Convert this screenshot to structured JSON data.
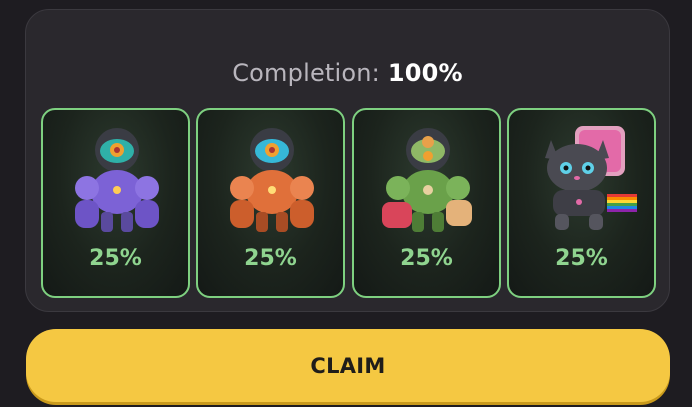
{
  "completion": {
    "label": "Completion:",
    "value": "100%"
  },
  "cards": [
    {
      "name": "purple-robot-icon",
      "percent": "25%",
      "body_color": "#7c62d6",
      "accent": "#a993f0"
    },
    {
      "name": "orange-robot-icon",
      "percent": "25%",
      "body_color": "#e0703a",
      "accent": "#f29a5f"
    },
    {
      "name": "green-robot-icon",
      "percent": "25%",
      "body_color": "#6aa14a",
      "accent": "#d9455a"
    },
    {
      "name": "robot-cat-icon",
      "percent": "25%",
      "body_color": "#4a4a52",
      "accent": "#e36aa8"
    }
  ],
  "claim_button": {
    "label": "CLAIM",
    "color": "#f5c842"
  }
}
